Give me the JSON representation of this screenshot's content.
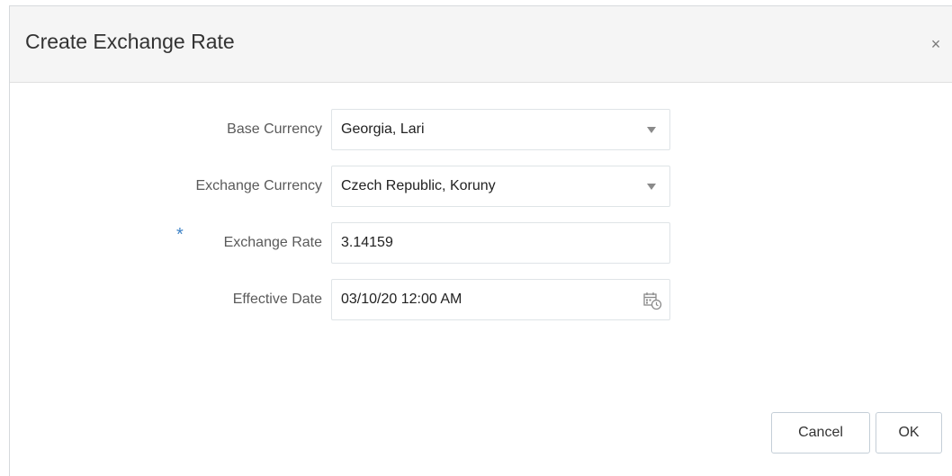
{
  "dialog": {
    "title": "Create Exchange Rate",
    "close_symbol": "×"
  },
  "form": {
    "base_currency": {
      "label": "Base Currency",
      "value": "Georgia, Lari",
      "icon": "chevron-down-icon"
    },
    "exchange_currency": {
      "label": "Exchange Currency",
      "value": "Czech Republic, Koruny",
      "icon": "chevron-down-icon"
    },
    "exchange_rate": {
      "label": "Exchange Rate",
      "value": "3.14159",
      "required_marker": "*"
    },
    "effective_date": {
      "label": "Effective Date",
      "value": "03/10/20 12:00 AM",
      "icon": "calendar-clock-icon"
    }
  },
  "buttons": {
    "cancel": "Cancel",
    "ok": "OK"
  },
  "colors": {
    "header_bg": "#f5f5f5",
    "required_marker": "#3f83c6",
    "field_border": "#dfe4e7",
    "button_border": "#c4ced7"
  }
}
